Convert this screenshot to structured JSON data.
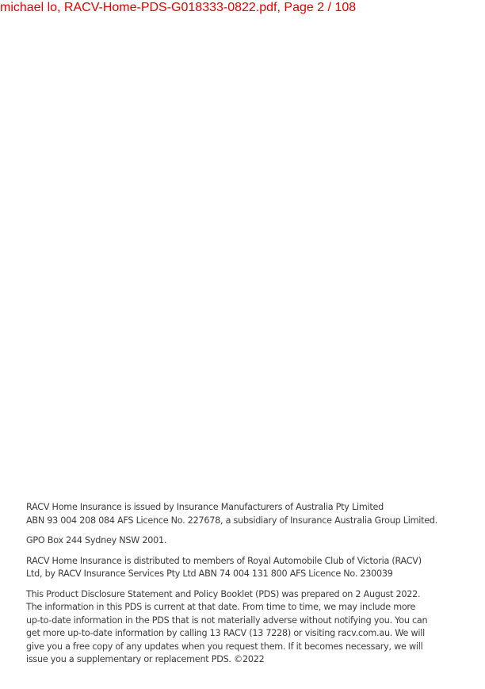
{
  "header": {
    "text": "michael lo, RACV-Home-PDS-G018333-0822.pdf, Page 2 / 108"
  },
  "footer": {
    "issuer_lines": [
      "RACV Home Insurance is issued by Insurance Manufacturers of Australia Pty Limited",
      "ABN 93 004 208 084 AFS Licence No. 227678, a subsidiary of Insurance Australia Group Limited."
    ],
    "address_lines": [
      "GPO Box 244 Sydney NSW 2001."
    ],
    "distribution_lines": [
      "RACV Home Insurance is distributed to members of Royal Automobile Club of Victoria (RACV)",
      "Ltd, by RACV Insurance Services Pty Ltd ABN 74 004 131 800 AFS Licence No. 230039"
    ],
    "pds_lines": [
      "This Product Disclosure Statement and Policy Booklet (PDS) was prepared on 2 August 2022.",
      "The information in this PDS is current at that date. From time to time, we may include more",
      "up-to-date information in the PDS that is not materially adverse without notifying you. You can",
      "get more up-to-date information by calling 13 RACV (13 7228) or visiting racv.com.au. We will",
      "give you a free copy of any updates when you request them. If it becomes necessary, we will",
      "issue you a supplementary or replacement PDS. ©2022"
    ]
  }
}
